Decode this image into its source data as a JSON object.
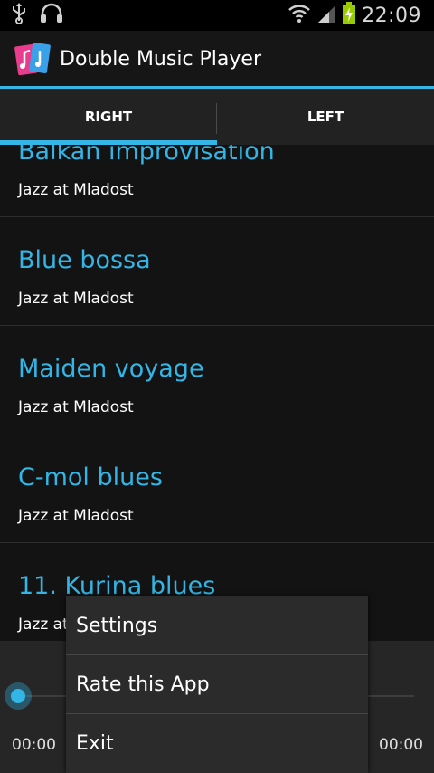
{
  "status_bar": {
    "time": "22:09",
    "icons": [
      "usb-icon",
      "headset-icon",
      "wifi-icon",
      "signal-icon",
      "battery-charging-icon"
    ]
  },
  "action_bar": {
    "title": "Double Music Player",
    "icon": "app-icon"
  },
  "tabs": [
    {
      "label": "RIGHT",
      "selected": true
    },
    {
      "label": "LEFT",
      "selected": false
    }
  ],
  "songs": [
    {
      "title": "Balkan improvisation",
      "artist": "Jazz at Mladost"
    },
    {
      "title": "Blue bossa",
      "artist": "Jazz at Mladost"
    },
    {
      "title": "Maiden voyage",
      "artist": "Jazz at Mladost"
    },
    {
      "title": "C-mol blues",
      "artist": "Jazz at Mladost"
    },
    {
      "title": "11. Kurina blues",
      "artist": "Jazz at Mladost"
    }
  ],
  "player": {
    "elapsed": "00:00",
    "total": "00:00",
    "progress": 0
  },
  "menu": {
    "items": [
      "Settings",
      "Rate this App",
      "Exit"
    ]
  },
  "colors": {
    "accent": "#33b5e5",
    "background": "#131313"
  }
}
